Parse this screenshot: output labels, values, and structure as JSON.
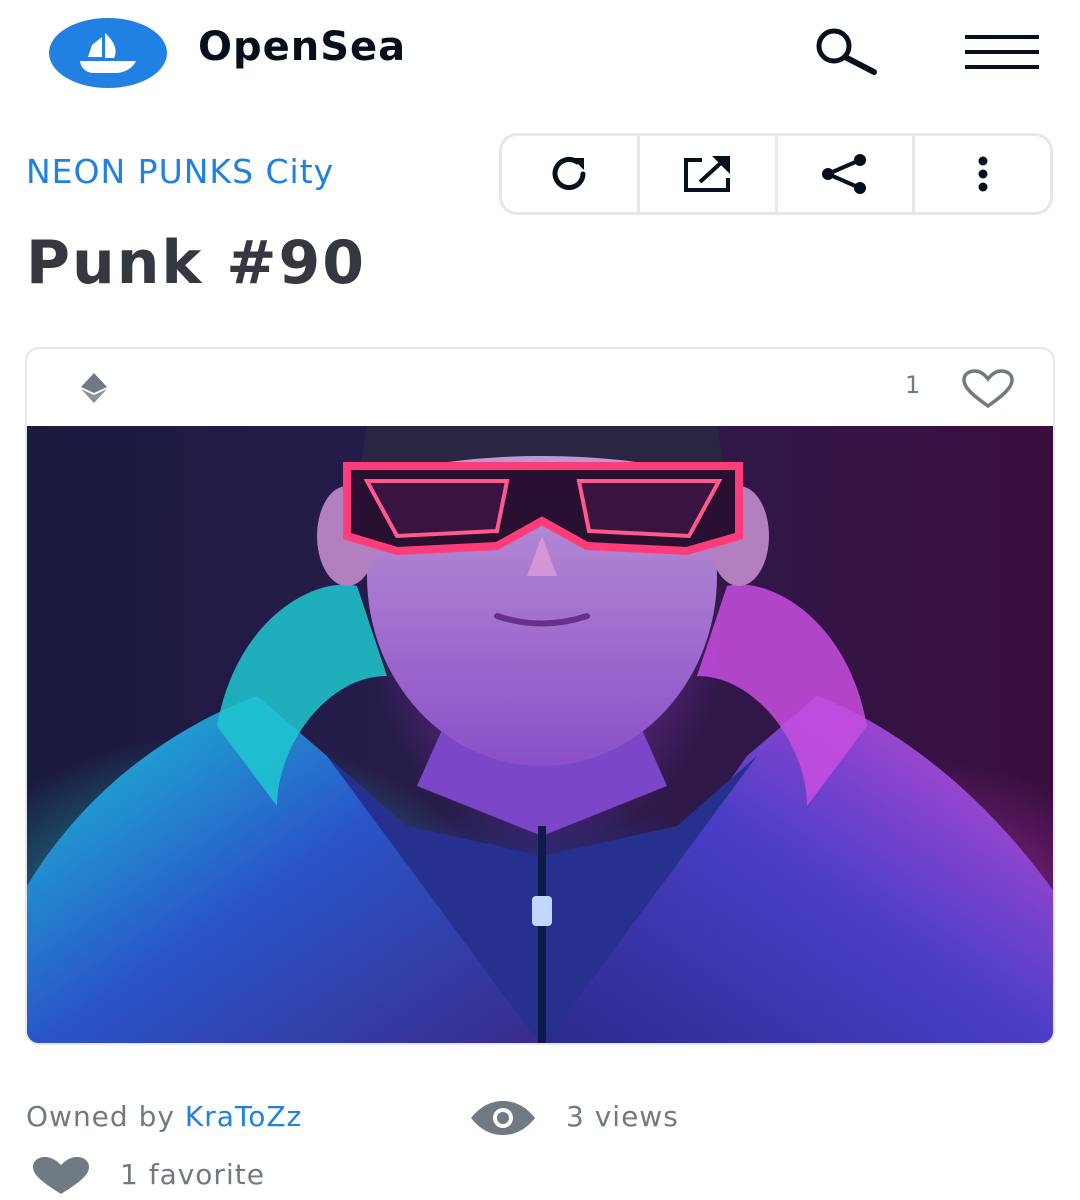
{
  "header": {
    "brand": "OpenSea",
    "icons": {
      "logo": "opensea-logo-icon",
      "search": "search-icon",
      "menu": "hamburger-menu-icon"
    },
    "colors": {
      "brand_blue": "#2081e2",
      "brand_text": "#04111d"
    }
  },
  "collection": {
    "name": "NEON PUNKS City"
  },
  "actions": [
    {
      "icon": "refresh-icon"
    },
    {
      "icon": "external-link-icon"
    },
    {
      "icon": "share-icon"
    },
    {
      "icon": "more-options-icon"
    }
  ],
  "item": {
    "title": "Punk #90"
  },
  "card": {
    "chain_icon": "ethereum-icon",
    "favorite_count": "1",
    "heart_icon": "heart-outline-icon",
    "image_description": "neon punk artwork"
  },
  "stats": {
    "owned_prefix": "Owned by",
    "owner": "KraToZz",
    "views": "3 views",
    "favorites": "1 favorite"
  }
}
